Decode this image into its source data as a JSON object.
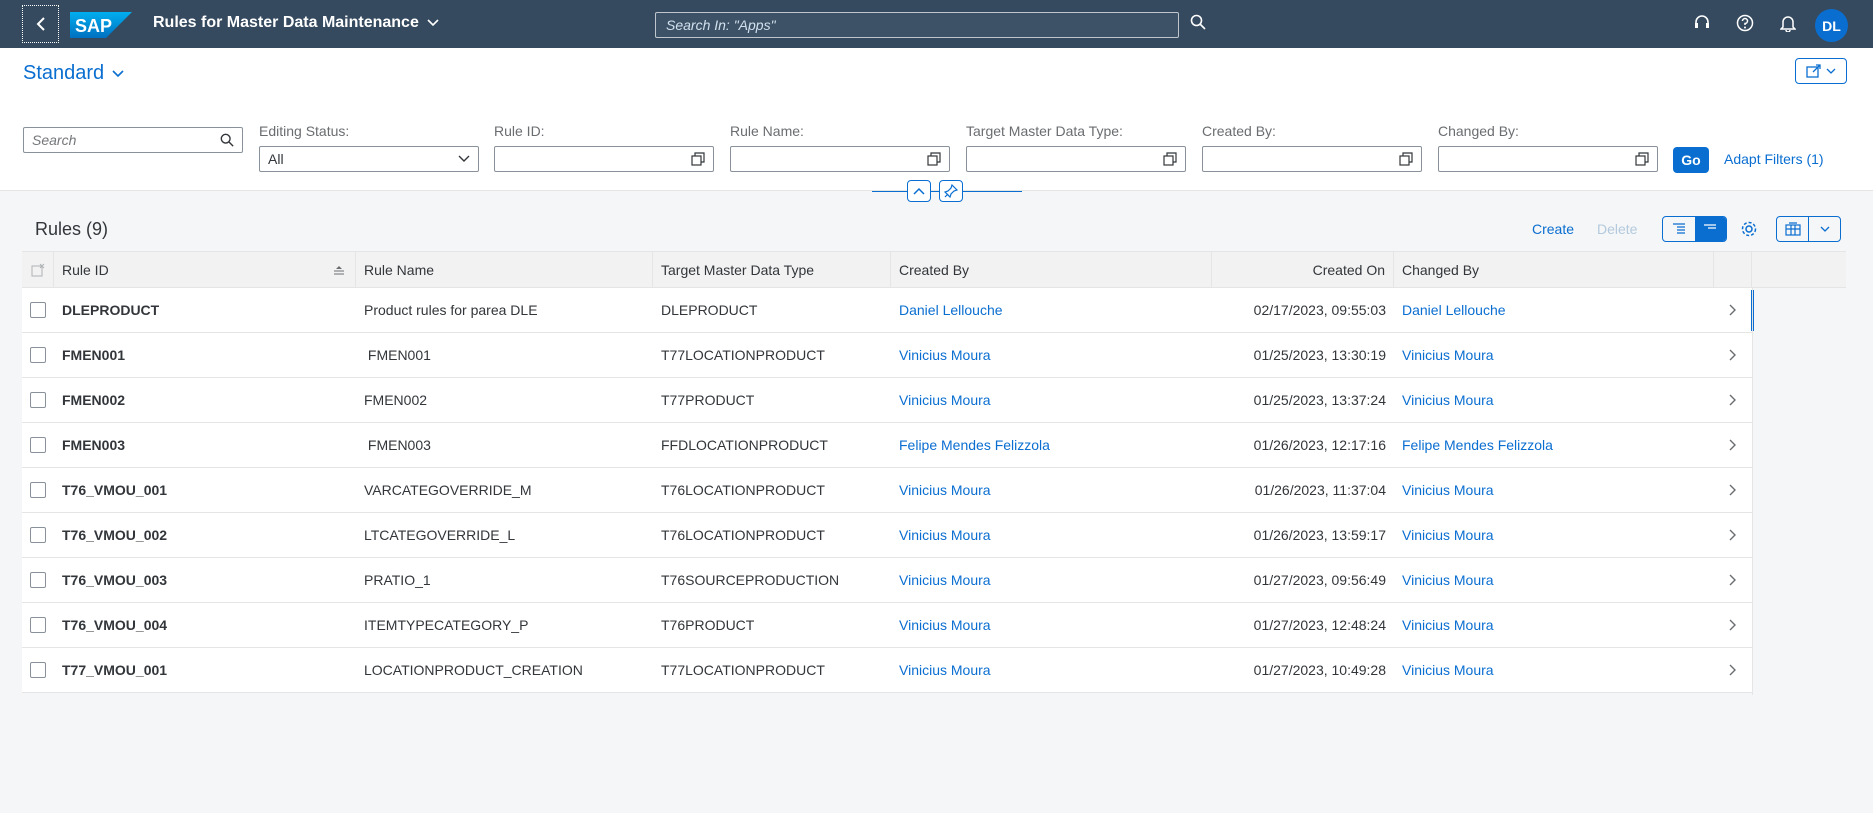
{
  "shell": {
    "title": "Rules for Master Data Maintenance",
    "search_placeholder": "Search In: \"Apps\"",
    "avatar_initials": "DL"
  },
  "header": {
    "variant": "Standard",
    "search_placeholder": "Search",
    "filters": [
      {
        "label": "Editing Status:",
        "value": "All"
      },
      {
        "label": "Rule ID:",
        "value": ""
      },
      {
        "label": "Rule Name:",
        "value": ""
      },
      {
        "label": "Target Master Data Type:",
        "value": ""
      },
      {
        "label": "Created By:",
        "value": ""
      },
      {
        "label": "Changed By:",
        "value": ""
      }
    ],
    "go_label": "Go",
    "adapt_label": "Adapt Filters (1)"
  },
  "table": {
    "title": "Rules (9)",
    "create_label": "Create",
    "delete_label": "Delete",
    "columns": [
      "Rule ID",
      "Rule Name",
      "Target Master Data Type",
      "Created By",
      "Created On",
      "Changed By"
    ],
    "rows": [
      {
        "id": "DLEPRODUCT",
        "name": "Product rules for parea DLE",
        "target": "DLEPRODUCT",
        "created_by": "Daniel Lellouche",
        "created_on": "02/17/2023, 09:55:03",
        "changed_by": "Daniel Lellouche"
      },
      {
        "id": "FMEN001",
        "name": " FMEN001",
        "target": "T77LOCATIONPRODUCT",
        "created_by": "Vinicius Moura",
        "created_on": "01/25/2023, 13:30:19",
        "changed_by": "Vinicius Moura"
      },
      {
        "id": "FMEN002",
        "name": "FMEN002",
        "target": "T77PRODUCT",
        "created_by": "Vinicius Moura",
        "created_on": "01/25/2023, 13:37:24",
        "changed_by": "Vinicius Moura"
      },
      {
        "id": "FMEN003",
        "name": " FMEN003",
        "target": "FFDLOCATIONPRODUCT",
        "created_by": "Felipe Mendes Felizzola",
        "created_on": "01/26/2023, 12:17:16",
        "changed_by": "Felipe Mendes Felizzola"
      },
      {
        "id": "T76_VMOU_001",
        "name": "VARCATEGOVERRIDE_M",
        "target": "T76LOCATIONPRODUCT",
        "created_by": "Vinicius Moura",
        "created_on": "01/26/2023, 11:37:04",
        "changed_by": "Vinicius Moura"
      },
      {
        "id": "T76_VMOU_002",
        "name": "LTCATEGOVERRIDE_L",
        "target": "T76LOCATIONPRODUCT",
        "created_by": "Vinicius Moura",
        "created_on": "01/26/2023, 13:59:17",
        "changed_by": "Vinicius Moura"
      },
      {
        "id": "T76_VMOU_003",
        "name": "PRATIO_1",
        "target": "T76SOURCEPRODUCTION",
        "created_by": "Vinicius Moura",
        "created_on": "01/27/2023, 09:56:49",
        "changed_by": "Vinicius Moura"
      },
      {
        "id": "T76_VMOU_004",
        "name": "ITEMTYPECATEGORY_P",
        "target": "T76PRODUCT",
        "created_by": "Vinicius Moura",
        "created_on": "01/27/2023, 12:48:24",
        "changed_by": "Vinicius Moura"
      },
      {
        "id": "T77_VMOU_001",
        "name": "LOCATIONPRODUCT_CREATION",
        "target": "T77LOCATIONPRODUCT",
        "created_by": "Vinicius Moura",
        "created_on": "01/27/2023, 10:49:28",
        "changed_by": "Vinicius Moura"
      }
    ]
  },
  "colors": {
    "shell": "#354a5f",
    "accent": "#0a6ed1",
    "background": "#f5f6f7"
  }
}
